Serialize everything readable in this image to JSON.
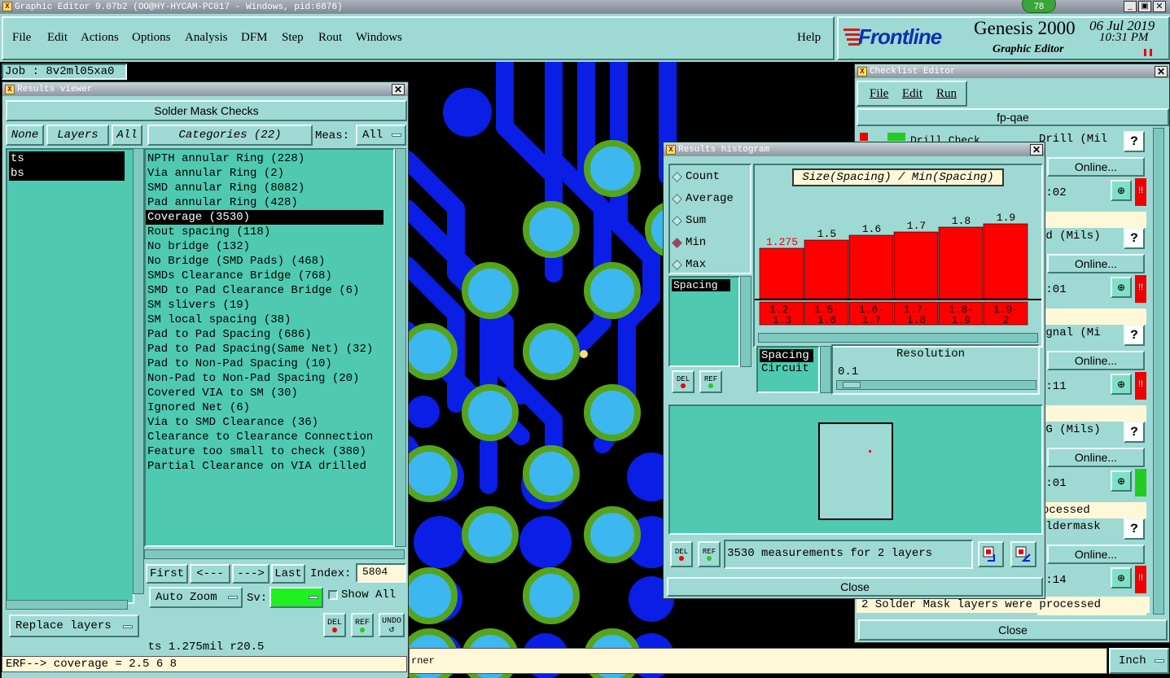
{
  "app": {
    "title": "Graphic Editor 9.07b2 (OO@HY-HYCAM-PC017 - Windows, pid:6876)",
    "badge": "78"
  },
  "menubar": {
    "items": [
      "File",
      "Edit",
      "Actions",
      "Options",
      "Analysis",
      "DFM",
      "Step",
      "Rout",
      "Windows"
    ],
    "help": "Help"
  },
  "brand": {
    "logo": "Frontline",
    "product": "Genesis 2000",
    "subtitle": "Graphic Editor",
    "date": "06 Jul 2019",
    "time": "10:31 PM"
  },
  "job": {
    "label": "Job : 8v2ml05xa0"
  },
  "results_viewer": {
    "title": "Results viewer",
    "heading": "Solder Mask Checks",
    "none_label": "None",
    "layers_label": "Layers",
    "all_label": "All",
    "layers": [
      "ts",
      "bs"
    ],
    "categories_label": "Categories (22)",
    "meas_label": "Meas:",
    "meas_value": "All",
    "categories": [
      "NPTH annular Ring (228)",
      "Via annular Ring (2)",
      "SMD annular Ring (8082)",
      "Pad annular Ring (428)",
      "Coverage (3530)",
      "Rout spacing (118)",
      "No bridge (132)",
      "No Bridge (SMD Pads) (468)",
      "SMDs Clearance Bridge (768)",
      "SMD to Pad Clearance Bridge (6)",
      "SM slivers (19)",
      "SM local spacing (38)",
      "Pad to Pad Spacing (686)",
      "Pad to Pad Spacing(Same Net) (32)",
      "Pad to Non-Pad Spacing (10)",
      "Non-Pad to Non-Pad Spacing (20)",
      "Covered VIA to SM (30)",
      "Ignored Net (6)",
      "Via to SMD Clearance (36)",
      "Clearance to Clearance Connection",
      "Feature too small to check (380)",
      "Partial Clearance on VIA drilled"
    ],
    "selected_index": 4,
    "first": "First",
    "prev": "<---",
    "next": "--->",
    "last": "Last",
    "index_label": "Index:",
    "index_value": "5804",
    "auto_zoom": "Auto Zoom",
    "sv_label": "Sv:",
    "show_all": "Show All",
    "replace_layers": "Replace layers",
    "del": "DEL",
    "ref": "REF",
    "undo": "UNDO",
    "status": "ts 1.275mil  r20.5",
    "erf": "ERF--> coverage = 2.5 6 8"
  },
  "histogram": {
    "title": "Results histogram",
    "modes": [
      "Count",
      "Average",
      "Sum",
      "Min",
      "Max"
    ],
    "selected_mode": "Min",
    "measure_list": [
      "Spacing"
    ],
    "chart_title": "Size(Spacing) / Min(Spacing)",
    "bar_values": [
      "1.275",
      "1.5",
      "1.6",
      "1.7",
      "1.8",
      "1.9"
    ],
    "bar_ranges": [
      [
        "1.2-",
        "1.3"
      ],
      [
        "1.5-",
        "1.6"
      ],
      [
        "1.6-",
        "1.7"
      ],
      [
        "1.7-",
        "1.8"
      ],
      [
        "1.8-",
        "1.9"
      ],
      [
        "1.9-",
        "2"
      ]
    ],
    "attr_list": [
      "Spacing",
      "Circuit"
    ],
    "resolution_label": "Resolution",
    "resolution_value": "0.1",
    "del": "DEL",
    "ref": "REF",
    "summary": "3530 measurements for 2 layers",
    "close": "Close"
  },
  "checklist": {
    "title": "Checklist Editor",
    "menu": [
      "File",
      "Edit",
      "Run"
    ],
    "name": "fp-qae",
    "rows": [
      {
        "label": "Drill (Mil",
        "online": "Online...",
        "time": "0:02"
      },
      {
        "label": "td (Mils)",
        "online": "Online...",
        "time": "0:01"
      },
      {
        "label": "ignal (Mi",
        "online": "Online...",
        "time": "1:11"
      },
      {
        "label": "/G (Mils)",
        "online": "Online...",
        "time": "0:01",
        "status": "ocessed"
      },
      {
        "label": "oldermask",
        "online": "Online...",
        "time": "0:14"
      }
    ],
    "first_row_partial": "Drill Check",
    "message": "2 Solder Mask layers were processed",
    "close": "Close"
  },
  "bottom": {
    "cmd_text": "rner",
    "units": "Inch"
  },
  "colors": {
    "panel": "#9fd9d3",
    "list_bg": "#4fcab0",
    "canvas": "#000000",
    "trace": "#0a1ee6",
    "pad": "#3db7f0",
    "ring": "#55a51c",
    "bar": "#ff0000"
  }
}
